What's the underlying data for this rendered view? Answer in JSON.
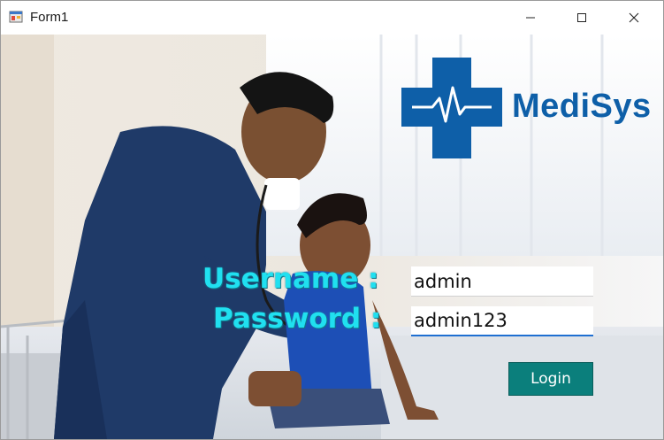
{
  "window": {
    "title": "Form1",
    "minimize_glyph": "—",
    "maximize_glyph": "☐",
    "close_glyph": "✕"
  },
  "logo": {
    "text": "MediSys",
    "icon": "medical-cross-heartbeat-icon",
    "color": "#0e5fa8"
  },
  "form": {
    "username_label": "Username :",
    "password_label": "Password :",
    "username_value": "admin",
    "password_value": "admin123",
    "login_label": "Login"
  },
  "colors": {
    "label": "#20e0f0",
    "button": "#0b7f7c",
    "brand": "#0e5fa8"
  }
}
